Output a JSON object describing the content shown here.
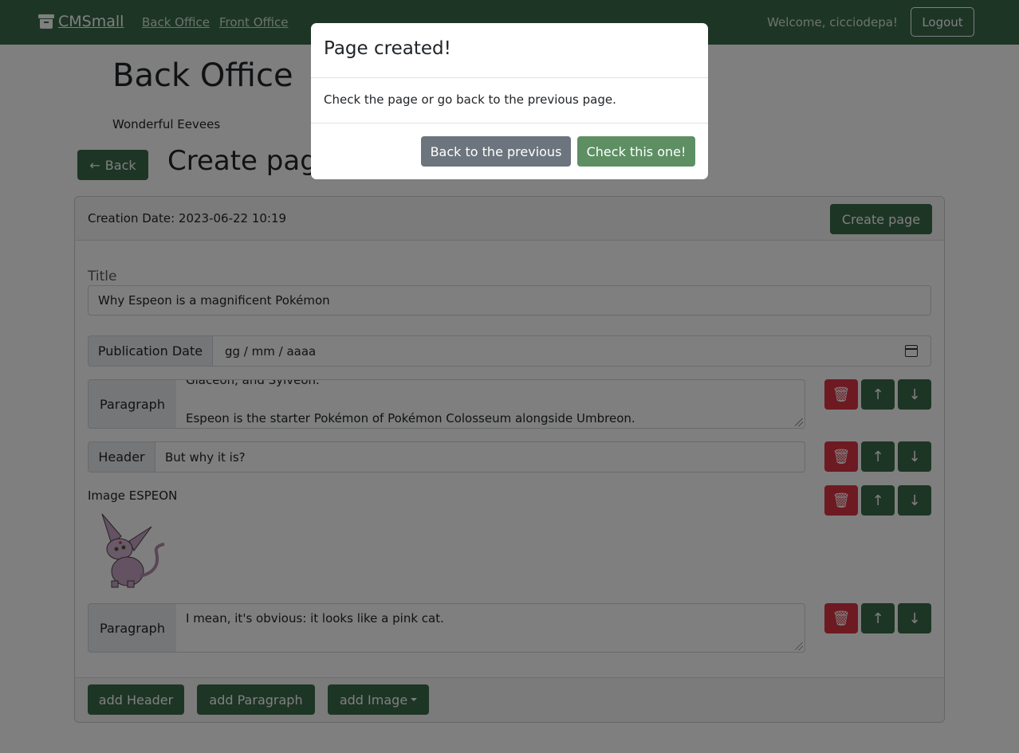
{
  "navbar": {
    "brand": "CMSmall",
    "links": [
      "Back Office",
      "Front Office"
    ],
    "welcome": "Welcome, cicciodepa!",
    "logout": "Logout"
  },
  "page": {
    "title": "Back Office",
    "site_name": "Wonderful Eevees",
    "back_label": "Back",
    "heading": "Create page"
  },
  "form": {
    "creation_date": "Creation Date: 2023-06-22 10:19",
    "create_button": "Create page",
    "title_label": "Title",
    "title_value": "Why Espeon is a magnificent Pokémon",
    "publication_label": "Publication Date",
    "publication_placeholder": "gg / mm / aaaa",
    "blocks": [
      {
        "type": "Paragraph",
        "line1": "Glaceon, and Sylveon.",
        "line2": "",
        "line3": "Espeon is the starter Pokémon of Pokémon Colosseum alongside Umbreon."
      },
      {
        "type": "Header",
        "value": "But why it is?"
      },
      {
        "type": "Image",
        "label": "Image ESPEON"
      },
      {
        "type": "Paragraph",
        "value": "I mean, it's obvious: it looks like a pink cat."
      }
    ],
    "footer": {
      "add_header": "add Header",
      "add_paragraph": "add Paragraph",
      "add_image": "add Image"
    }
  },
  "modal": {
    "title": "Page created!",
    "body": "Check the page or go back to the previous page.",
    "secondary": "Back to the previous",
    "primary": "Check this one!"
  },
  "colors": {
    "navbar": "#3a6a4a",
    "danger": "#dc3545",
    "secondary": "#6c757d"
  }
}
